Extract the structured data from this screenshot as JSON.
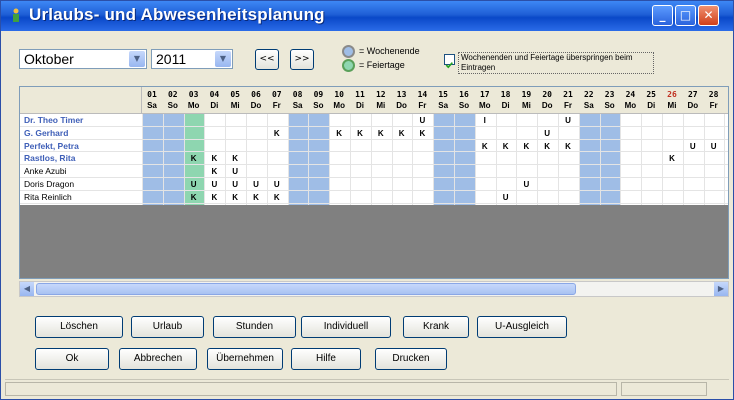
{
  "window": {
    "title": "Urlaubs- und Abwesenheitsplanung",
    "controls": [
      "minimize",
      "maximize",
      "close"
    ]
  },
  "toolbar": {
    "month": "Oktober",
    "year": "2011",
    "prev_label": "<<",
    "next_label": ">>",
    "legend_weekend": "= Wochenende",
    "legend_holiday": "= Feiertage",
    "skip_checkbox_label": "Wochenenden und Feiertage überspringen beim Eintragen",
    "skip_checked": true
  },
  "grid": {
    "days": [
      "01",
      "02",
      "03",
      "04",
      "05",
      "06",
      "07",
      "08",
      "09",
      "10",
      "11",
      "12",
      "13",
      "14",
      "15",
      "16",
      "17",
      "18",
      "19",
      "20",
      "21",
      "22",
      "23",
      "24",
      "25",
      "26",
      "27",
      "28"
    ],
    "weekdays": [
      "Sa",
      "So",
      "Mo",
      "Di",
      "Mi",
      "Do",
      "Fr",
      "Sa",
      "So",
      "Mo",
      "Di",
      "Mi",
      "Do",
      "Fr",
      "Sa",
      "So",
      "Mo",
      "Di",
      "Mi",
      "Do",
      "Fr",
      "Sa",
      "So",
      "Mo",
      "Di",
      "Mi",
      "Do",
      "Fr"
    ],
    "weekend_indices": [
      0,
      1,
      7,
      8,
      14,
      15,
      21,
      22
    ],
    "holiday_indices": [
      2
    ],
    "highlight_day_index": 25,
    "employees": [
      {
        "name": "Dr. Theo Timer",
        "style": "blue",
        "marks": {
          "13": "U",
          "16": "I",
          "20": "U"
        }
      },
      {
        "name": "G. Gerhard",
        "style": "blue",
        "marks": {
          "6": "K",
          "9": "K",
          "10": "K",
          "11": "K",
          "12": "K",
          "13": "K",
          "19": "U"
        }
      },
      {
        "name": "Perfekt, Petra",
        "style": "blue",
        "marks": {
          "16": "K",
          "17": "K",
          "18": "K",
          "19": "K",
          "20": "K",
          "26": "U",
          "27": "U"
        }
      },
      {
        "name": "Rastlos, Rita",
        "style": "blue",
        "marks": {
          "2": "K",
          "3": "K",
          "4": "K",
          "25": "K"
        }
      },
      {
        "name": "Anke Azubi",
        "style": "black",
        "marks": {
          "3": "K",
          "4": "U"
        }
      },
      {
        "name": "Doris Dragon",
        "style": "black",
        "marks": {
          "2": "U",
          "3": "U",
          "4": "U",
          "5": "U",
          "6": "U",
          "18": "U"
        }
      },
      {
        "name": "Rita Reinlich",
        "style": "black",
        "marks": {
          "2": "K",
          "3": "K",
          "4": "K",
          "5": "K",
          "6": "K",
          "17": "U"
        }
      }
    ]
  },
  "buttons_row1": [
    {
      "name": "loeschen-button",
      "label": "Löschen"
    },
    {
      "name": "urlaub-button",
      "label": "Urlaub"
    },
    {
      "name": "stunden-button",
      "label": "Stunden"
    },
    {
      "name": "individuell-button",
      "label": "Individuell"
    },
    {
      "name": "krank-button",
      "label": "Krank"
    },
    {
      "name": "u-ausgleich-button",
      "label": "U-Ausgleich"
    }
  ],
  "buttons_row2": [
    {
      "name": "ok-button",
      "label": "Ok"
    },
    {
      "name": "abbrechen-button",
      "label": "Abbrechen"
    },
    {
      "name": "uebernehmen-button",
      "label": "Übernehmen"
    },
    {
      "name": "hilfe-button",
      "label": "Hilfe"
    },
    {
      "name": "drucken-button",
      "label": "Drucken"
    }
  ]
}
